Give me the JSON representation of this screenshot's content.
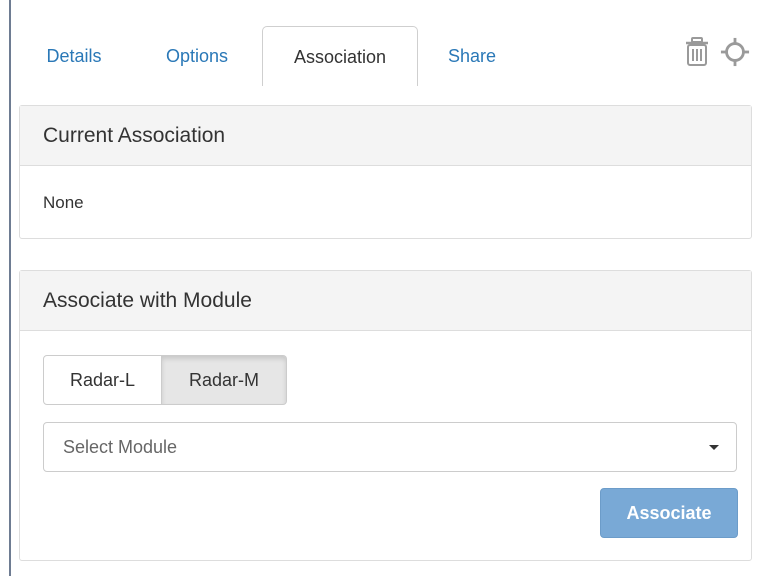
{
  "tabs": [
    {
      "label": "Details"
    },
    {
      "label": "Options"
    },
    {
      "label": "Association"
    },
    {
      "label": "Share"
    }
  ],
  "toolbar": {
    "delete_icon": "trash-icon",
    "locate_icon": "crosshair-icon",
    "icon_color": "#9a9a9a"
  },
  "current_association": {
    "heading": "Current Association",
    "value": "None"
  },
  "associate_module": {
    "heading": "Associate with Module",
    "radar_options": [
      "Radar-L",
      "Radar-M"
    ],
    "selected_radar": "Radar-M",
    "select": {
      "selected_text": "Select Module"
    },
    "submit_label": "Associate",
    "submit_color": "#79a9d6"
  },
  "colors": {
    "link": "#2a78b7",
    "panel_heading_bg": "#f4f4f4",
    "border": "#dddddd"
  }
}
